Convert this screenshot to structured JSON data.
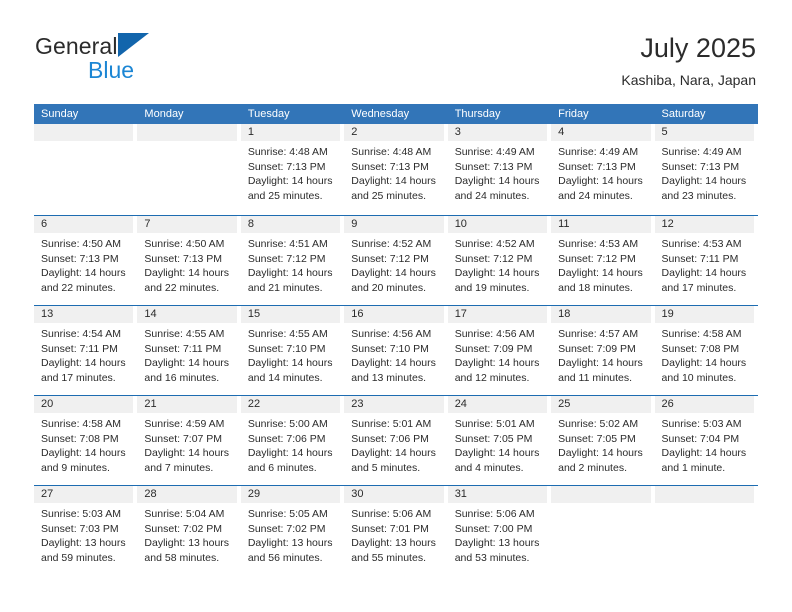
{
  "brand": {
    "name_part1": "General",
    "name_part2": "Blue",
    "logo_icon": "triangle-logo-icon",
    "colors": {
      "general_text": "#2b2b2b",
      "blue_text": "#1c86d4",
      "triangle": "#1265ac"
    }
  },
  "header": {
    "title": "July 2025",
    "subtitle": "Kashiba, Nara, Japan"
  },
  "theme": {
    "header_blue": "#3275b8",
    "row_divider_blue": "#1d6cb1",
    "day_strip_gray": "#f0f0f0"
  },
  "calendar": {
    "weekdays": [
      "Sunday",
      "Monday",
      "Tuesday",
      "Wednesday",
      "Thursday",
      "Friday",
      "Saturday"
    ],
    "weeks": [
      [
        {
          "day": "",
          "lines": []
        },
        {
          "day": "",
          "lines": []
        },
        {
          "day": "1",
          "lines": [
            "Sunrise: 4:48 AM",
            "Sunset: 7:13 PM",
            "Daylight: 14 hours",
            "and 25 minutes."
          ]
        },
        {
          "day": "2",
          "lines": [
            "Sunrise: 4:48 AM",
            "Sunset: 7:13 PM",
            "Daylight: 14 hours",
            "and 25 minutes."
          ]
        },
        {
          "day": "3",
          "lines": [
            "Sunrise: 4:49 AM",
            "Sunset: 7:13 PM",
            "Daylight: 14 hours",
            "and 24 minutes."
          ]
        },
        {
          "day": "4",
          "lines": [
            "Sunrise: 4:49 AM",
            "Sunset: 7:13 PM",
            "Daylight: 14 hours",
            "and 24 minutes."
          ]
        },
        {
          "day": "5",
          "lines": [
            "Sunrise: 4:49 AM",
            "Sunset: 7:13 PM",
            "Daylight: 14 hours",
            "and 23 minutes."
          ]
        }
      ],
      [
        {
          "day": "6",
          "lines": [
            "Sunrise: 4:50 AM",
            "Sunset: 7:13 PM",
            "Daylight: 14 hours",
            "and 22 minutes."
          ]
        },
        {
          "day": "7",
          "lines": [
            "Sunrise: 4:50 AM",
            "Sunset: 7:13 PM",
            "Daylight: 14 hours",
            "and 22 minutes."
          ]
        },
        {
          "day": "8",
          "lines": [
            "Sunrise: 4:51 AM",
            "Sunset: 7:12 PM",
            "Daylight: 14 hours",
            "and 21 minutes."
          ]
        },
        {
          "day": "9",
          "lines": [
            "Sunrise: 4:52 AM",
            "Sunset: 7:12 PM",
            "Daylight: 14 hours",
            "and 20 minutes."
          ]
        },
        {
          "day": "10",
          "lines": [
            "Sunrise: 4:52 AM",
            "Sunset: 7:12 PM",
            "Daylight: 14 hours",
            "and 19 minutes."
          ]
        },
        {
          "day": "11",
          "lines": [
            "Sunrise: 4:53 AM",
            "Sunset: 7:12 PM",
            "Daylight: 14 hours",
            "and 18 minutes."
          ]
        },
        {
          "day": "12",
          "lines": [
            "Sunrise: 4:53 AM",
            "Sunset: 7:11 PM",
            "Daylight: 14 hours",
            "and 17 minutes."
          ]
        }
      ],
      [
        {
          "day": "13",
          "lines": [
            "Sunrise: 4:54 AM",
            "Sunset: 7:11 PM",
            "Daylight: 14 hours",
            "and 17 minutes."
          ]
        },
        {
          "day": "14",
          "lines": [
            "Sunrise: 4:55 AM",
            "Sunset: 7:11 PM",
            "Daylight: 14 hours",
            "and 16 minutes."
          ]
        },
        {
          "day": "15",
          "lines": [
            "Sunrise: 4:55 AM",
            "Sunset: 7:10 PM",
            "Daylight: 14 hours",
            "and 14 minutes."
          ]
        },
        {
          "day": "16",
          "lines": [
            "Sunrise: 4:56 AM",
            "Sunset: 7:10 PM",
            "Daylight: 14 hours",
            "and 13 minutes."
          ]
        },
        {
          "day": "17",
          "lines": [
            "Sunrise: 4:56 AM",
            "Sunset: 7:09 PM",
            "Daylight: 14 hours",
            "and 12 minutes."
          ]
        },
        {
          "day": "18",
          "lines": [
            "Sunrise: 4:57 AM",
            "Sunset: 7:09 PM",
            "Daylight: 14 hours",
            "and 11 minutes."
          ]
        },
        {
          "day": "19",
          "lines": [
            "Sunrise: 4:58 AM",
            "Sunset: 7:08 PM",
            "Daylight: 14 hours",
            "and 10 minutes."
          ]
        }
      ],
      [
        {
          "day": "20",
          "lines": [
            "Sunrise: 4:58 AM",
            "Sunset: 7:08 PM",
            "Daylight: 14 hours",
            "and 9 minutes."
          ]
        },
        {
          "day": "21",
          "lines": [
            "Sunrise: 4:59 AM",
            "Sunset: 7:07 PM",
            "Daylight: 14 hours",
            "and 7 minutes."
          ]
        },
        {
          "day": "22",
          "lines": [
            "Sunrise: 5:00 AM",
            "Sunset: 7:06 PM",
            "Daylight: 14 hours",
            "and 6 minutes."
          ]
        },
        {
          "day": "23",
          "lines": [
            "Sunrise: 5:01 AM",
            "Sunset: 7:06 PM",
            "Daylight: 14 hours",
            "and 5 minutes."
          ]
        },
        {
          "day": "24",
          "lines": [
            "Sunrise: 5:01 AM",
            "Sunset: 7:05 PM",
            "Daylight: 14 hours",
            "and 4 minutes."
          ]
        },
        {
          "day": "25",
          "lines": [
            "Sunrise: 5:02 AM",
            "Sunset: 7:05 PM",
            "Daylight: 14 hours",
            "and 2 minutes."
          ]
        },
        {
          "day": "26",
          "lines": [
            "Sunrise: 5:03 AM",
            "Sunset: 7:04 PM",
            "Daylight: 14 hours",
            "and 1 minute."
          ]
        }
      ],
      [
        {
          "day": "27",
          "lines": [
            "Sunrise: 5:03 AM",
            "Sunset: 7:03 PM",
            "Daylight: 13 hours",
            "and 59 minutes."
          ]
        },
        {
          "day": "28",
          "lines": [
            "Sunrise: 5:04 AM",
            "Sunset: 7:02 PM",
            "Daylight: 13 hours",
            "and 58 minutes."
          ]
        },
        {
          "day": "29",
          "lines": [
            "Sunrise: 5:05 AM",
            "Sunset: 7:02 PM",
            "Daylight: 13 hours",
            "and 56 minutes."
          ]
        },
        {
          "day": "30",
          "lines": [
            "Sunrise: 5:06 AM",
            "Sunset: 7:01 PM",
            "Daylight: 13 hours",
            "and 55 minutes."
          ]
        },
        {
          "day": "31",
          "lines": [
            "Sunrise: 5:06 AM",
            "Sunset: 7:00 PM",
            "Daylight: 13 hours",
            "and 53 minutes."
          ]
        },
        {
          "day": "",
          "lines": []
        },
        {
          "day": "",
          "lines": []
        }
      ]
    ]
  }
}
